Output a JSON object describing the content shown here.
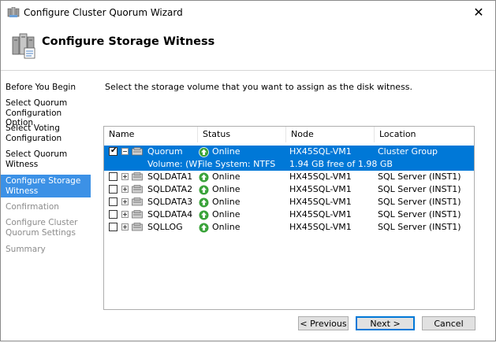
{
  "window": {
    "title": "Configure Cluster Quorum Wizard",
    "close_glyph": "✕"
  },
  "header": {
    "title": "Configure Storage Witness"
  },
  "sidebar": {
    "items": [
      {
        "label": "Before You Begin",
        "state": "normal"
      },
      {
        "label": "Select Quorum Configuration Option",
        "state": "normal"
      },
      {
        "label": "Select Voting Configuration",
        "state": "normal"
      },
      {
        "label": "Select Quorum Witness",
        "state": "normal"
      },
      {
        "label": "Configure Storage Witness",
        "state": "selected"
      },
      {
        "label": "Confirmation",
        "state": "disabled"
      },
      {
        "label": "Configure Cluster Quorum Settings",
        "state": "disabled"
      },
      {
        "label": "Summary",
        "state": "disabled"
      }
    ]
  },
  "main": {
    "instruction": "Select the storage volume that you want to assign as the disk witness.",
    "columns": [
      "Name",
      "Status",
      "Node",
      "Location"
    ],
    "rows": [
      {
        "checked": true,
        "expanded": true,
        "name": "Quorum",
        "status": "Online",
        "node": "HX45SQL-VM1",
        "location": "Cluster Group",
        "selected": true
      },
      {
        "sub": true,
        "name": "Volume: (W)",
        "status": "File System: NTFS",
        "node": "1.94 GB free of 1.98 GB",
        "selected": true
      },
      {
        "checked": false,
        "expanded": false,
        "name": "SQLDATA1",
        "status": "Online",
        "node": "HX45SQL-VM1",
        "location": "SQL Server (INST1)"
      },
      {
        "checked": false,
        "expanded": false,
        "name": "SQLDATA2",
        "status": "Online",
        "node": "HX45SQL-VM1",
        "location": "SQL Server (INST1)"
      },
      {
        "checked": false,
        "expanded": false,
        "name": "SQLDATA3",
        "status": "Online",
        "node": "HX45SQL-VM1",
        "location": "SQL Server (INST1)"
      },
      {
        "checked": false,
        "expanded": false,
        "name": "SQLDATA4",
        "status": "Online",
        "node": "HX45SQL-VM1",
        "location": "SQL Server (INST1)"
      },
      {
        "checked": false,
        "expanded": false,
        "name": "SQLLOG",
        "status": "Online",
        "node": "HX45SQL-VM1",
        "location": "SQL Server (INST1)"
      }
    ]
  },
  "buttons": {
    "previous": "< Previous",
    "next": "Next >",
    "cancel": "Cancel"
  },
  "colors": {
    "selected_row": "#0078d7",
    "nav_selected": "#3c91e6",
    "online_icon": "#3aa33a"
  }
}
